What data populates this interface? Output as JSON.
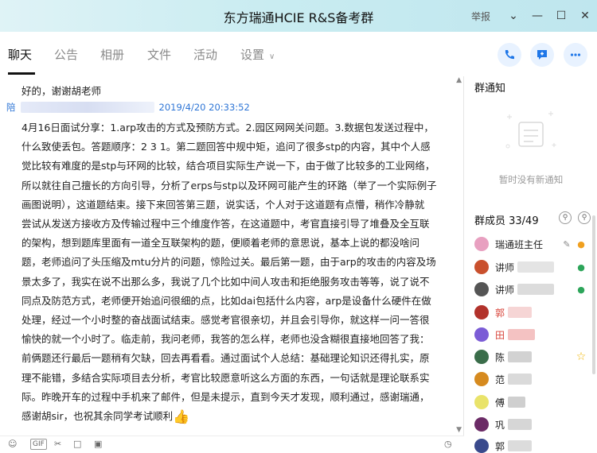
{
  "window": {
    "title": "东方瑞通HCIE R&S备考群",
    "report_label": "举报"
  },
  "tabs": [
    {
      "label": "聊天"
    },
    {
      "label": "公告"
    },
    {
      "label": "相册"
    },
    {
      "label": "文件"
    },
    {
      "label": "活动"
    },
    {
      "label": "设置"
    }
  ],
  "actions": {
    "call": "phone-icon",
    "message": "chat-bubble-icon",
    "more": "more-icon"
  },
  "chat": {
    "prev_message": "好的，谢谢胡老师",
    "sender_prefix": "陪",
    "timestamp": "2019/4/20 20:33:52",
    "body_lines": [
      "4月16日面试分享：1.arp攻击的方式及预防方式。2.园区网网关问题。3.数据包发送过程中，",
      "什么致使丢包。答题顺序：2 3 1。第二题回答中规中矩，追问了很多stp的内容，其中个人感",
      "觉比较有难度的是stp与环网的比较，结合项目实际生产说一下，由于做了比较多的工业网络，",
      "所以就往自己擅长的方向引导，分析了erps与stp以及环网可能产生的环路（举了一个实际例子",
      "画图说明），这道题结束。接下来回答第三题，说实话，个人对于这道题有点懵，稍作冷静就",
      "尝试从发送方接收方及传输过程中三个维度作答，在这道题中，考官直接引导了堆叠及全互联",
      "的架构，想到题库里面有一道全互联架构的题，便顺着老师的意思说，基本上说的都没啥问",
      "题，老师追问了头压缩及mtu分片的问题，惊险过关。最后第一题，由于arp的攻击的内容及场",
      "景太多了，我实在说不出那么多，我说了几个比如中间人攻击和拒绝服务攻击等等，说了说不",
      "同点及防范方式，老师便开始追问很细的点，比如dai包括什么内容，arp是设备什么硬件在做",
      "处理，经过一个小时整的奋战面试结束。感觉考官很亲切，并且会引导你，就这样一问一答很",
      "愉快的就一个小时了。临走前，我问老师，我答的怎么样，老师也没含糊很直接地回答了我：",
      "前俩题还行最后一题稍有欠缺，回去再看看。通过面试个人总结：基础理论知识还得扎实，原",
      "理不能错，多结合实际项目去分析，考官比较愿意听这么方面的东西，一句话就是理论联系实",
      "际。昨晚开车的过程中手机来了邮件，但是未提示，直到今天才发现，顺利通过，感谢瑞通，",
      "感谢胡sir，也祝其余同学考试顺利"
    ],
    "emoji": "👍"
  },
  "notice": {
    "title": "群通知",
    "empty_text": "暂时没有新通知"
  },
  "members": {
    "title": "群成员 33/49",
    "list": [
      {
        "name": "瑞通班主任",
        "badge": "owner",
        "avatar_color": "#e8a0c0"
      },
      {
        "name": "讲师",
        "badge": "admin",
        "avatar_color": "#c9502d"
      },
      {
        "name": "讲师",
        "badge": "admin",
        "avatar_color": "#555555"
      },
      {
        "name": "郭",
        "badge": "",
        "avatar_color": "#b2322b"
      },
      {
        "name": "田",
        "badge": "",
        "avatar_color": "#7b5cd6"
      },
      {
        "name": "陈",
        "badge": "star",
        "avatar_color": "#3a6d4a"
      },
      {
        "name": "范",
        "badge": "",
        "avatar_color": "#d68a1f"
      },
      {
        "name": "傅",
        "badge": "",
        "avatar_color": "#e9e36a"
      },
      {
        "name": "巩",
        "badge": "",
        "avatar_color": "#6b2b66"
      },
      {
        "name": "郭",
        "badge": "",
        "avatar_color": "#3a4a8c"
      }
    ]
  }
}
